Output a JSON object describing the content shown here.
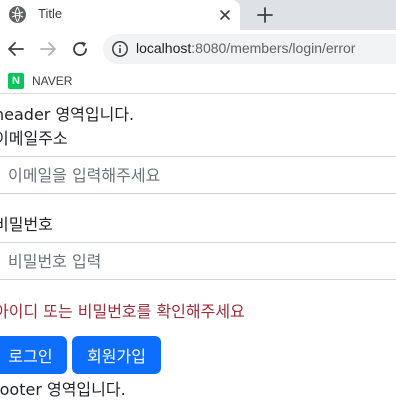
{
  "browser": {
    "tab_title": "Title",
    "url_host": "localhost",
    "url_rest": ":8080/members/login/error",
    "bookmark_label": "NAVER",
    "bookmark_logo": "N"
  },
  "page": {
    "header_text": "header 영역입니다.",
    "email_label": "이메일주소",
    "email_placeholder": "이메일을 입력해주세요",
    "password_label": "비밀번호",
    "password_placeholder": "비밀번호 입력",
    "error_message": "아이디 또는 비밀번호를 확인해주세요",
    "login_button": "로그인",
    "signup_button": "회원가입",
    "footer_text": "footer 영역입니다."
  },
  "colors": {
    "primary_button": "#0d6efd",
    "error_text": "#a02d3a",
    "naver_green": "#03c75a"
  }
}
